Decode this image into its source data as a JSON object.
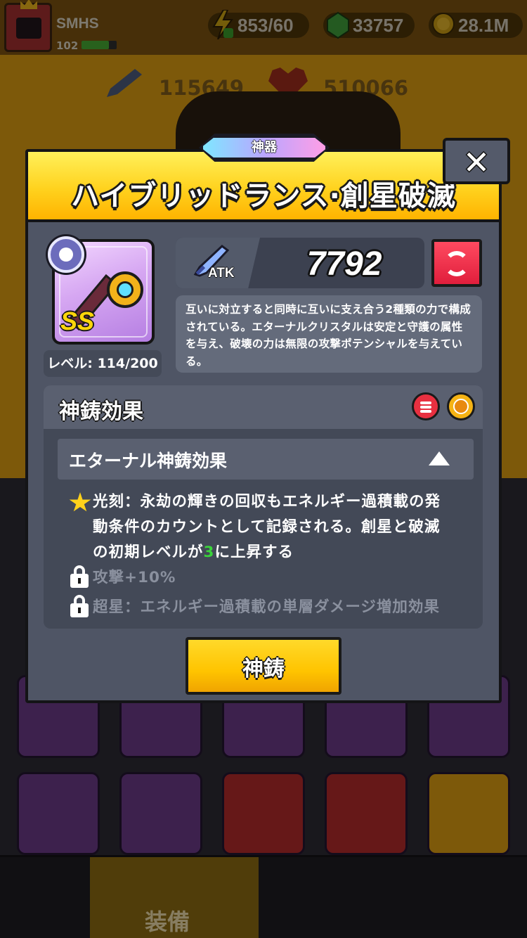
{
  "player": {
    "name": "SMHS",
    "level": "102",
    "xp_progress": 0.78
  },
  "resources": {
    "energy": "853/60",
    "gems": "33757",
    "coins": "28.1M"
  },
  "background_stats": {
    "atk_label": "ATK",
    "atk_value": "115649",
    "hp_label": "HP",
    "hp_value": "510066"
  },
  "modal": {
    "badge": "神器",
    "title": "ハイブリッドランス·創星破滅",
    "close_label": "✕",
    "item": {
      "rank": "SS",
      "level_text": "レベル: 114/200"
    },
    "atk": {
      "label": "ATK",
      "value": "7792"
    },
    "description": "互いに対立すると同時に互いに支え合う2種類の力で構成されている。エターナルクリスタルは安定と守護の属性を与え、破壊の力は無限の攻撃ポテンシャルを与えている。",
    "section": {
      "title": "神鋳効果",
      "subsection_title": "エターナル神鋳効果",
      "effects": [
        {
          "prefix": "光刻：永劫の輝きの回収もエネルギー過積載の発",
          "line2": "動条件のカウントとして記録される。創星と破滅",
          "line3_pre": "の初期レベルが",
          "highlight": "3",
          "line3_post": "に上昇する"
        },
        {
          "text": "攻撃+10%"
        },
        {
          "text": "超星：エネルギー過積載の単層ダメージ増加効果"
        }
      ]
    },
    "forge_button": "神鋳"
  },
  "tabbar": {
    "active_label": "装備"
  },
  "colors": {
    "header_yellow": "#ffd21e",
    "panel_gray": "#4f5565",
    "highlight_green": "#3ad33a",
    "refresh_red": "#e01e3c"
  }
}
